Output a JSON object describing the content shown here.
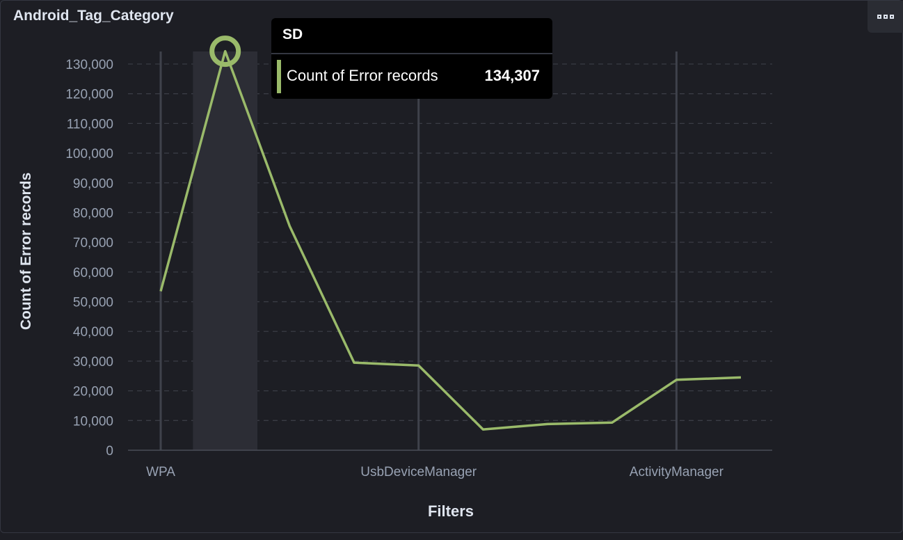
{
  "panel": {
    "title": "Android_Tag_Category"
  },
  "tooltip": {
    "category": "SD",
    "label": "Count of Error records",
    "value": "134,307"
  },
  "chart_data": {
    "type": "line",
    "xlabel": "Filters",
    "ylabel": "Count of Error records",
    "categories": [
      "WPA",
      "SD",
      "",
      "",
      "UsbDeviceManager",
      "",
      "",
      "",
      "ActivityManager",
      ""
    ],
    "visible_tick_labels": [
      "WPA",
      "UsbDeviceManager",
      "ActivityManager"
    ],
    "values": [
      53500,
      134307,
      75500,
      29500,
      28500,
      7000,
      8800,
      9300,
      23700,
      24500
    ],
    "ylim": [
      0,
      135000
    ],
    "yticks": [
      0,
      10000,
      20000,
      30000,
      40000,
      50000,
      60000,
      70000,
      80000,
      90000,
      100000,
      110000,
      120000,
      130000
    ],
    "ytick_labels": [
      "0",
      "10,000",
      "20,000",
      "30,000",
      "40,000",
      "50,000",
      "60,000",
      "70,000",
      "80,000",
      "90,000",
      "100,000",
      "110,000",
      "120,000",
      "130,000"
    ],
    "highlighted_index": 1,
    "grid": true,
    "series_color": "#9aba6a"
  }
}
